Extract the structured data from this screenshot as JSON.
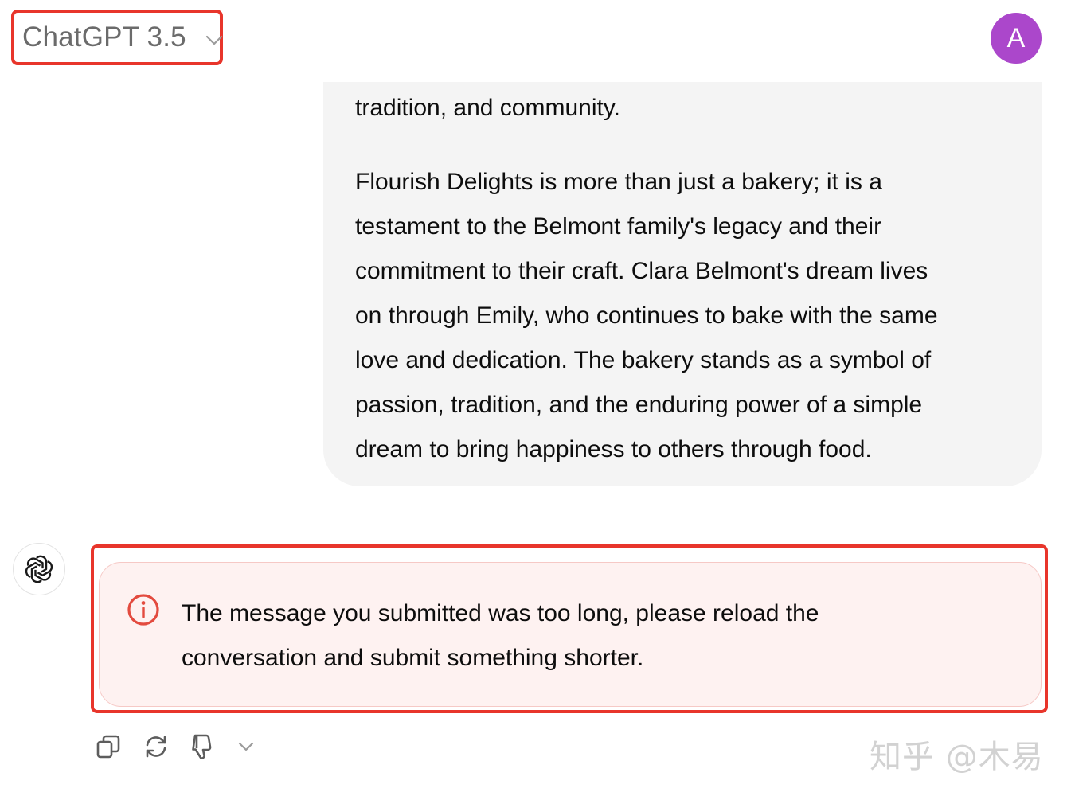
{
  "header": {
    "model_name": "ChatGPT 3.5",
    "user_initial": "A"
  },
  "user_message": {
    "paragraph_1": [
      "tradition, and community."
    ],
    "paragraph_2": [
      "Flourish Delights is more than just a bakery; it is a",
      "testament to the Belmont family's legacy and their",
      "commitment to their craft. Clara Belmont's dream lives",
      "on through Emily, who continues to bake with the same",
      "love and dedication. The bakery stands as a symbol of",
      "passion, tradition, and the enduring power of a simple",
      "dream to bring happiness to others through food."
    ]
  },
  "assistant": {
    "icon": "openai-logo-icon",
    "error_icon": "info-circle-icon",
    "error_lines": [
      "The message you submitted was too long, please reload the",
      "conversation and submit something shorter."
    ]
  },
  "actions": {
    "icons": [
      "copy-icon",
      "regenerate-icon",
      "thumbs-down-icon",
      "chevron-down-icon"
    ]
  },
  "watermark": "知乎 @木易",
  "colors": {
    "highlight_red": "#e8352b",
    "avatar_purple": "#ab47cb",
    "error_bg": "#fef2f1",
    "bubble_bg": "#f4f4f4"
  }
}
